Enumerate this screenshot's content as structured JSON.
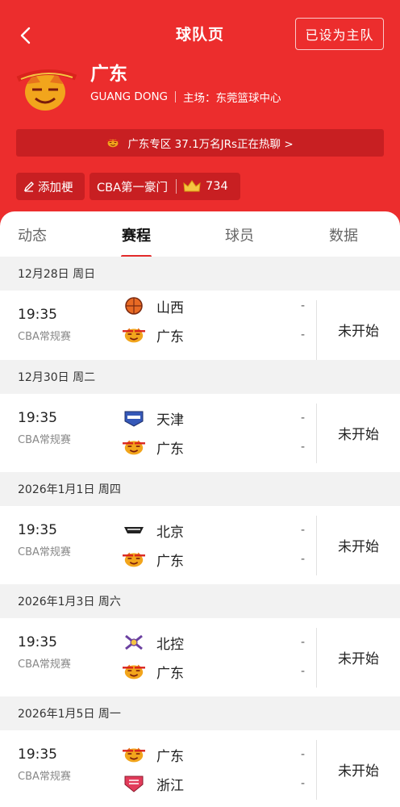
{
  "header": {
    "title": "球队页",
    "home_button": "已设为主队",
    "team_name": "广东",
    "team_en": "GUANG DONG",
    "venue": "主场：东莞篮球中心",
    "banner": "广东专区 37.1万名JRs正在热聊 >",
    "edit_label": "添加梗",
    "rank_label": "CBA第一豪门",
    "rank_count": "734",
    "accent": "#ec2d2d"
  },
  "tabs": [
    "动态",
    "赛程",
    "球员",
    "数据"
  ],
  "active_tab": 1,
  "dates": [
    "12月28日 周日",
    "12月30日 周二",
    "2026年1月1日 周四",
    "2026年1月3日 周六",
    "2026年1月5日 周一"
  ],
  "matches": [
    {
      "time": "19:35",
      "league": "CBA常规赛",
      "home": "山西",
      "away": "广东",
      "home_score": "-",
      "away_score": "-",
      "status": "未开始"
    },
    {
      "time": "19:35",
      "league": "CBA常规赛",
      "home": "天津",
      "away": "广东",
      "home_score": "-",
      "away_score": "-",
      "status": "未开始"
    },
    {
      "time": "19:35",
      "league": "CBA常规赛",
      "home": "北京",
      "away": "广东",
      "home_score": "-",
      "away_score": "-",
      "status": "未开始"
    },
    {
      "time": "19:35",
      "league": "CBA常规赛",
      "home": "北控",
      "away": "广东",
      "home_score": "-",
      "away_score": "-",
      "status": "未开始"
    },
    {
      "time": "19:35",
      "league": "CBA常规赛",
      "home": "广东",
      "away": "浙江",
      "home_score": "-",
      "away_score": "-",
      "status": "未开始"
    }
  ]
}
